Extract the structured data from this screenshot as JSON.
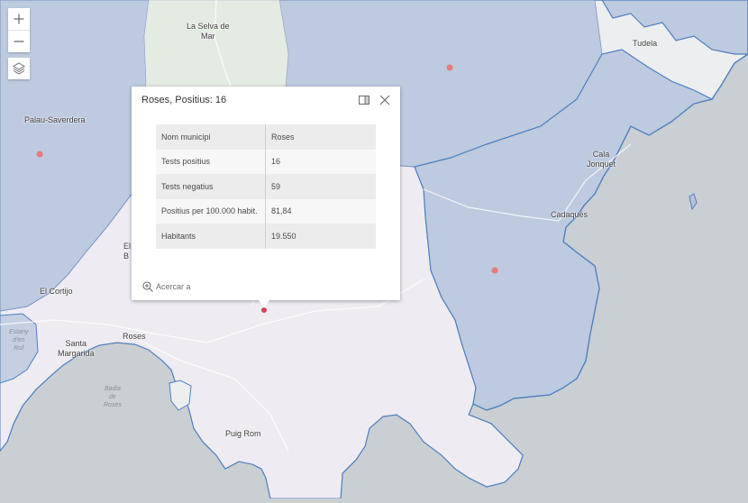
{
  "map": {
    "places": [
      {
        "name": "La Selva de\nMar",
        "cls": "place"
      },
      {
        "name": "Tudela",
        "cls": "place"
      },
      {
        "name": "Palau-Saverdera",
        "cls": "place"
      },
      {
        "name": "Cala\nJonquet",
        "cls": "place"
      },
      {
        "name": "Cadaqués",
        "cls": "place"
      },
      {
        "name": "El\nB",
        "cls": "place"
      },
      {
        "name": "El Cortijo",
        "cls": "place"
      },
      {
        "name": "Roses",
        "cls": "place"
      },
      {
        "name": "Santa\nMargarida",
        "cls": "place"
      },
      {
        "name": "Puig Rom",
        "cls": "place"
      }
    ],
    "water_labels": [
      {
        "name": "Estany\nd'en\nRuf"
      },
      {
        "name": "Badia\nde\nRoses"
      }
    ],
    "colors": {
      "sea": "#c9cfd3",
      "land_base": "#eceef0",
      "selected_municipality": "#eeecf2",
      "neighbor_municipality": "#b5c3dc",
      "boundary": "#4f7fbf",
      "case_point": "#e87b7b",
      "green_area": "#e4ebe2"
    }
  },
  "controls": {
    "zoom_in_icon": "plus-icon",
    "zoom_out_icon": "minus-icon",
    "layers_icon": "layers-icon"
  },
  "popup": {
    "title": "Roses, Positius: 16",
    "rows": [
      {
        "key": "Nom municipi",
        "value": "Roses"
      },
      {
        "key": "Tests positius",
        "value": "16"
      },
      {
        "key": "Tests negatius",
        "value": "59"
      },
      {
        "key": "Positius per 100.000 habit.",
        "value": "81,84"
      },
      {
        "key": "Habitants",
        "value": "19.550"
      }
    ],
    "zoom_to_label": "Acercar a"
  }
}
